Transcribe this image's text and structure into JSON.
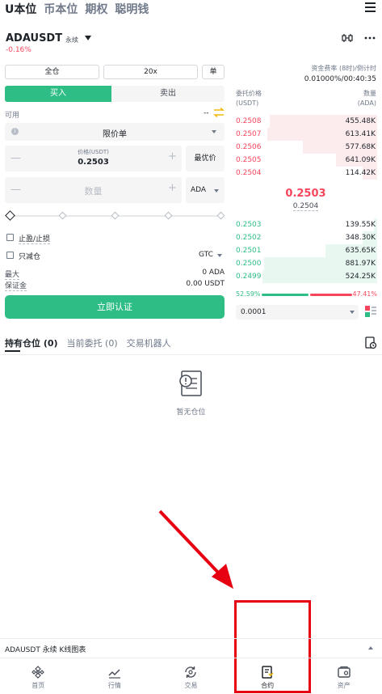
{
  "top_tabs": [
    "U本位",
    "币本位",
    "期权",
    "聪明钱"
  ],
  "symbol": {
    "name": "ADAUSDT",
    "type": "永续",
    "change": "-0.16%"
  },
  "controls": {
    "margin_mode": "全仓",
    "leverage": "20x",
    "position_mode": "单"
  },
  "funding": {
    "label": "资金费率 (8时)/倒计时",
    "value": "0.01000%/00:40:35"
  },
  "trade_tabs": {
    "buy": "买入",
    "sell": "卖出"
  },
  "available": {
    "label": "可用",
    "value": "--"
  },
  "order_type": {
    "label": "限价单"
  },
  "price": {
    "label": "价格(USDT)",
    "value": "0.2503",
    "best_label": "最优价"
  },
  "quantity": {
    "placeholder": "数量",
    "unit": "ADA"
  },
  "options": {
    "tp_sl": "止盈/止损",
    "reduce_only": "只减仓",
    "tif": "GTC"
  },
  "summary": {
    "max_label": "最大",
    "max_value": "0 ADA",
    "margin_label": "保证金",
    "margin_value": "0.00 USDT"
  },
  "auth_button": "立即认证",
  "orderbook": {
    "price_header": "委托价格",
    "price_unit": "(USDT)",
    "qty_header": "数量",
    "qty_unit": "(ADA)",
    "asks": [
      {
        "price": "0.2508",
        "qty": "455.48K",
        "depth": 0.75
      },
      {
        "price": "0.2507",
        "qty": "613.41K",
        "depth": 0.77
      },
      {
        "price": "0.2506",
        "qty": "577.68K",
        "depth": 0.52
      },
      {
        "price": "0.2505",
        "qty": "641.09K",
        "depth": 0.29
      },
      {
        "price": "0.2504",
        "qty": "114.42K",
        "depth": 0.1
      }
    ],
    "mid_price": "0.2503",
    "mark_price": "0.2504",
    "bids": [
      {
        "price": "0.2503",
        "qty": "139.55K",
        "depth": 0.02
      },
      {
        "price": "0.2502",
        "qty": "348.30K",
        "depth": 0.1
      },
      {
        "price": "0.2501",
        "qty": "635.65K",
        "depth": 0.36
      },
      {
        "price": "0.2500",
        "qty": "881.97K",
        "depth": 0.79
      },
      {
        "price": "0.2499",
        "qty": "524.25K",
        "depth": 0.8
      }
    ],
    "buy_ratio": "52.59%",
    "sell_ratio": "47.41%",
    "depth_step": "0.0001"
  },
  "position_tabs": [
    "持有仓位 (0)",
    "当前委托 (0)",
    "交易机器人"
  ],
  "empty_text": "暂无仓位",
  "kline_label": "ADAUSDT 永续 K线图表",
  "nav": [
    "首页",
    "行情",
    "交易",
    "合约",
    "资产"
  ],
  "colors": {
    "green": "#2ebd85",
    "red": "#f6465d",
    "highlight": "#e60012"
  }
}
